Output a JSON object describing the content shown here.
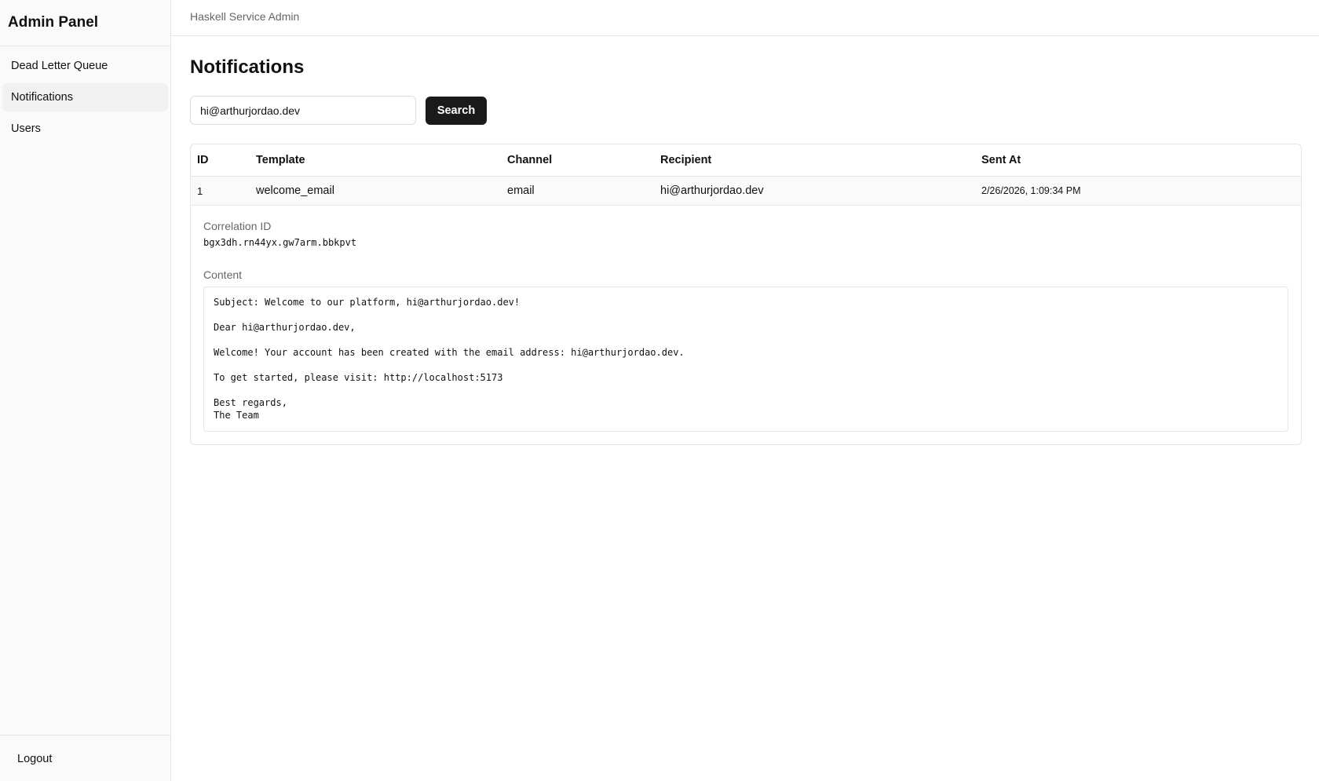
{
  "sidebar": {
    "title": "Admin Panel",
    "items": [
      {
        "label": "Dead Letter Queue",
        "active": false
      },
      {
        "label": "Notifications",
        "active": true
      },
      {
        "label": "Users",
        "active": false
      }
    ],
    "logout_label": "Logout"
  },
  "topbar": {
    "title": "Haskell Service Admin"
  },
  "main": {
    "page_title": "Notifications",
    "search": {
      "value": "hi@arthurjordao.dev",
      "button_label": "Search"
    },
    "table": {
      "columns": [
        "ID",
        "Template",
        "Channel",
        "Recipient",
        "Sent At"
      ],
      "rows": [
        {
          "id": "1",
          "template": "welcome_email",
          "channel": "email",
          "recipient": "hi@arthurjordao.dev",
          "sent_at": "2/26/2026, 1:09:34 PM"
        }
      ]
    },
    "details": {
      "correlation_label": "Correlation ID",
      "correlation_id": "bgx3dh.rn44yx.gw7arm.bbkpvt",
      "content_label": "Content",
      "content": "Subject: Welcome to our platform, hi@arthurjordao.dev!\n\nDear hi@arthurjordao.dev,\n\nWelcome! Your account has been created with the email address: hi@arthurjordao.dev.\n\nTo get started, please visit: http://localhost:5173\n\nBest regards,\nThe Team"
    }
  }
}
